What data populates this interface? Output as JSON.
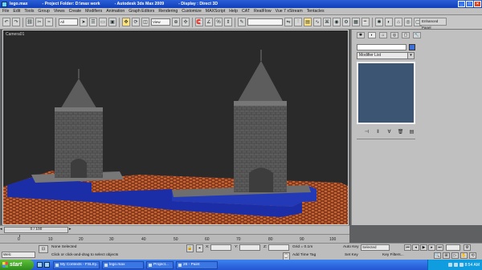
{
  "window": {
    "title_file": "lego.max",
    "title_project": "- Project Folder: D:\\max work",
    "title_app": "- Autodesk 3ds Max 2009",
    "title_display": "- Display : Direct 3D"
  },
  "menu": [
    "File",
    "Edit",
    "Tools",
    "Group",
    "Views",
    "Create",
    "Modifiers",
    "Animation",
    "Graph Editors",
    "Rendering",
    "Customize",
    "MAXScript",
    "Help",
    "CAT",
    "RealFlow",
    "Vue 7 xStream",
    "Tentacles"
  ],
  "toolbar": {
    "selection_filter": "All",
    "ref_coord": "View",
    "named_selection": "",
    "enhanced_panel": "Enhanced Panel"
  },
  "viewport": {
    "label": "Camera01"
  },
  "command_panel": {
    "modifier_list": "Modifier List"
  },
  "timeline": {
    "frame_slider": "0 / 100",
    "ticks": [
      "0",
      "10",
      "20",
      "30",
      "40",
      "50",
      "60",
      "70",
      "80",
      "90",
      "100"
    ]
  },
  "status": {
    "script_field": "Welc",
    "selection_status": "None Selected",
    "prompt": "Click or click-and-drag to select objects",
    "x_label": "X:",
    "y_label": "Y:",
    "z_label": "Z:",
    "grid": "Grid = 0.1m",
    "add_time_tag": "Add Time Tag",
    "auto_key": "Auto Key",
    "set_key": "Set Key",
    "selected": "Selected",
    "key_filters": "Key Filters..."
  },
  "taskbar": {
    "start": "start",
    "tasks": [
      "My Contexts - FSLEy...",
      "lego.max",
      "Project...",
      "26 - Paint"
    ],
    "clock": "8:54 AM"
  },
  "colors": {
    "water": "#1b2ea7",
    "bricks": "#8a3a1d",
    "viewport_bg": "#2a2a2a",
    "stack_bg": "#3b5572"
  }
}
